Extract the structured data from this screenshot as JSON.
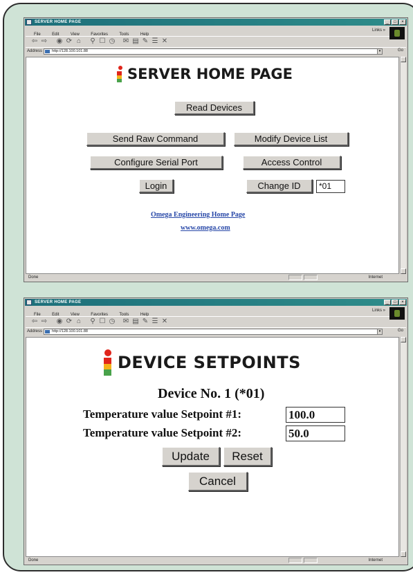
{
  "window1": {
    "title": "SERVER HOME PAGE",
    "menu": [
      "File",
      "Edit",
      "View",
      "Favorites",
      "Tools",
      "Help"
    ],
    "links_label": "Links »",
    "address_label": "Address",
    "address_value": "http://128.100.101.88",
    "go_label": "Go",
    "status_text": "Done",
    "zone_text": "Internet",
    "page": {
      "heading": "SERVER HOME PAGE",
      "read_devices": "Read Devices",
      "send_raw_command": "Send Raw Command",
      "modify_device_list": "Modify Device List",
      "configure_serial_port": "Configure Serial Port",
      "access_control": "Access Control",
      "login": "Login",
      "change_id": "Change ID",
      "id_value": "*01",
      "link_home": "Omega Engineering Home Page",
      "link_site": "www.omega.com"
    }
  },
  "window2": {
    "title": "SERVER HOME PAGE",
    "menu": [
      "File",
      "Edit",
      "View",
      "Favorites",
      "Tools",
      "Help"
    ],
    "links_label": "Links »",
    "address_label": "Address",
    "address_value": "http://128.100.101.88",
    "go_label": "Go",
    "status_text": "Done",
    "zone_text": "Internet",
    "page": {
      "heading": "DEVICE SETPOINTS",
      "device_label": "Device No. 1 (*01)",
      "setpoint1_label": "Temperature value Setpoint #1:",
      "setpoint1_value": "100.0",
      "setpoint2_label": "Temperature value Setpoint #2:",
      "setpoint2_value": "50.0",
      "update": "Update",
      "reset": "Reset",
      "cancel": "Cancel"
    }
  },
  "colors": {
    "frame_bg": "#cfe3d6",
    "titlebar": "#1d6f7a",
    "logo_red": "#e0251b",
    "logo_yellow": "#f5b21a",
    "logo_green": "#49a24a",
    "link": "#2848a8"
  }
}
